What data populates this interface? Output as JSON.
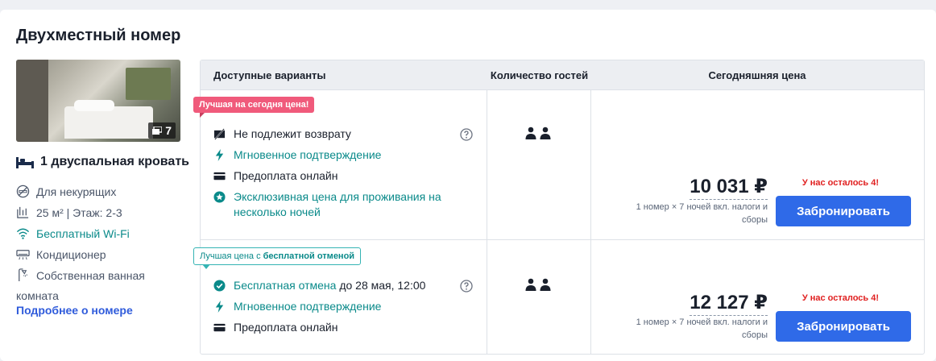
{
  "room": {
    "title": "Двухместный номер",
    "photo_count": "7",
    "bed": "1 двуспальная кровать",
    "amenities": [
      {
        "icon": "no-smoking-icon",
        "label": "Для некурящих",
        "highlight": false
      },
      {
        "icon": "area-icon",
        "label": "25 м² | Этаж: 2-3",
        "highlight": false
      },
      {
        "icon": "wifi-icon",
        "label": "Бесплатный Wi-Fi",
        "highlight": true
      },
      {
        "icon": "air-conditioner-icon",
        "label": "Кондиционер",
        "highlight": false
      },
      {
        "icon": "shower-icon",
        "label": "Собственная ванная",
        "highlight": false
      }
    ],
    "amenity_wrap": "комната",
    "more_link": "Подробнее о номере"
  },
  "table": {
    "headers": [
      "Доступные варианты",
      "Количество гостей",
      "Сегодняшняя цена"
    ],
    "options": [
      {
        "tag": "Лучшая на сегодня цена!",
        "features": [
          {
            "icon": "no-refund-icon",
            "text": "Не подлежит возврату"
          },
          {
            "icon": "lightning-icon",
            "text": "Мгновенное подтверждение"
          },
          {
            "icon": "card-icon",
            "text": "Предоплата онлайн"
          },
          {
            "icon": "star-badge-icon",
            "line1": "Эксклюзивная цена для проживания на",
            "line2": "несколько ночей"
          }
        ],
        "price": "10 031 ₽",
        "note_line1": "1 номер × 7 ночей вкл. налоги и",
        "note_line2": "сборы",
        "remaining": "У нас осталось 4!",
        "button": "Забронировать"
      },
      {
        "tag_prefix": "Лучшая цена с",
        "tag_bold": "бесплатной отменой",
        "features": [
          {
            "icon": "check-circle-icon",
            "text": "Бесплатная отмена",
            "suffix": "до 28 мая, 12:00"
          },
          {
            "icon": "lightning-icon",
            "text": "Мгновенное подтверждение"
          },
          {
            "icon": "card-icon",
            "text": "Предоплата онлайн"
          }
        ],
        "price": "12 127 ₽",
        "note_line1": "1 номер × 7 ночей вкл. налоги и",
        "note_line2": "сборы",
        "remaining": "У нас осталось 4!",
        "button": "Забронировать"
      }
    ]
  },
  "colors": {
    "accent": "#2f6ae8",
    "teal": "#0a8a8a",
    "promo": "#f05a7b",
    "alert": "#e02020"
  }
}
